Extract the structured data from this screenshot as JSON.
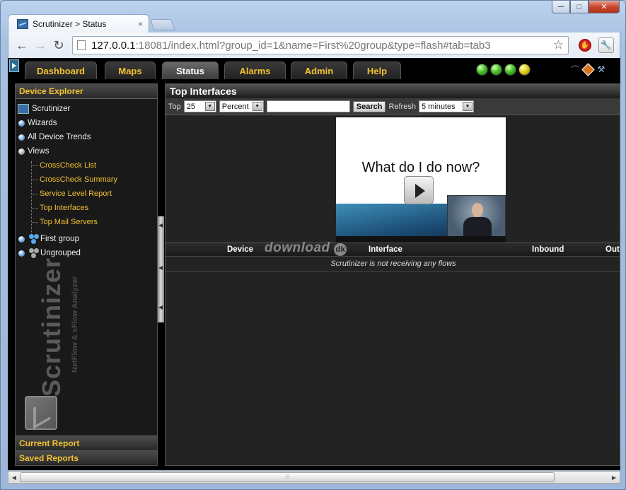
{
  "window": {
    "minimize": "─",
    "maximize": "□",
    "close": "✕"
  },
  "browser": {
    "tab_title": "Scrutinizer > Status",
    "tab_close": "×",
    "url_host": "127.0.0.1",
    "url_rest": ":18081/index.html?group_id=1&name=First%20group&type=flash#tab=tab3"
  },
  "app_nav": {
    "tabs": [
      "Dashboard",
      "Maps",
      "Status",
      "Alarms",
      "Admin",
      "Help"
    ],
    "active": "Status"
  },
  "left_panel": {
    "header": "Device Explorer",
    "tree": {
      "root": "Scrutinizer",
      "wizards": "Wizards",
      "all_device_trends": "All Device Trends",
      "views": "Views",
      "view_links": [
        "CrossCheck List",
        "CrossCheck Summary",
        "Service Level Report",
        "Top Interfaces",
        "Top Mail Servers"
      ],
      "first_group": "First group",
      "ungrouped": "Ungrouped"
    },
    "brand_name": "Scrutinizer",
    "brand_tagline": "NetFlow & sFlow Analyzer",
    "footer_current_report": "Current Report",
    "footer_saved_reports": "Saved Reports"
  },
  "main_panel": {
    "title": "Top Interfaces",
    "filter": {
      "top_label": "Top",
      "top_value": "25",
      "metric_value": "Percent",
      "search_value": "",
      "search_button": "Search",
      "refresh_label": "Refresh",
      "refresh_value": "5 minutes"
    },
    "video_text": "What do I do now?",
    "columns": [
      "Device",
      "Interface",
      "Inbound",
      "Outb"
    ],
    "empty_message": "Scrutinizer is not receiving any flows",
    "watermark": "download",
    "watermark_badge": "dk"
  },
  "colors": {
    "accent_yellow": "#f2c230",
    "panel_bg": "#191919",
    "status_green": "#49c22a",
    "status_yellow": "#e3d21c"
  },
  "status_lights": [
    "green",
    "green",
    "green",
    "yellow"
  ]
}
